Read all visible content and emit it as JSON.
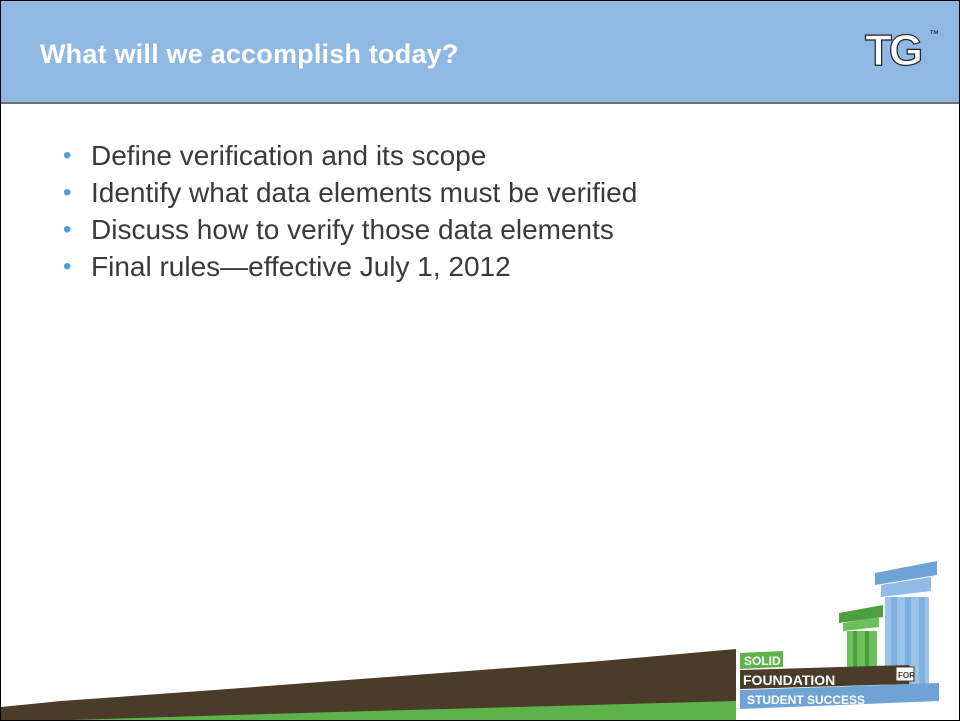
{
  "slide": {
    "title": "What will we accomplish today?",
    "bullets": [
      "Define verification and its scope",
      "Identify what data elements must be verified",
      "Discuss how to verify those data elements",
      "Final rules—effective July 1, 2012"
    ],
    "bullet_glyph": "•"
  },
  "logo": {
    "text": "TG",
    "trademark": "™"
  },
  "badge": {
    "line1": "SOLID",
    "line2": "FOUNDATION",
    "for": "FOR",
    "line3": "STUDENT SUCCESS"
  },
  "colors": {
    "header": "#8fb8e3",
    "bullet": "#4aa0d6",
    "text": "#3a3a3a",
    "footer_band": "#4a3c28",
    "footer_green": "#5db34a"
  }
}
